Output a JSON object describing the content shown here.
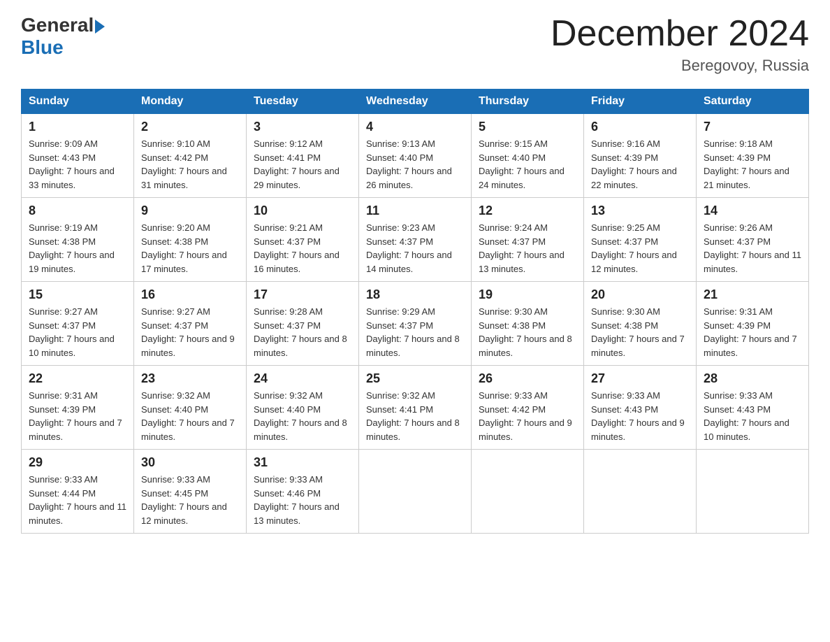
{
  "header": {
    "logo_general": "General",
    "logo_blue": "Blue",
    "title": "December 2024",
    "subtitle": "Beregovoy, Russia"
  },
  "columns": [
    "Sunday",
    "Monday",
    "Tuesday",
    "Wednesday",
    "Thursday",
    "Friday",
    "Saturday"
  ],
  "weeks": [
    [
      {
        "day": "1",
        "sunrise": "9:09 AM",
        "sunset": "4:43 PM",
        "daylight": "7 hours and 33 minutes."
      },
      {
        "day": "2",
        "sunrise": "9:10 AM",
        "sunset": "4:42 PM",
        "daylight": "7 hours and 31 minutes."
      },
      {
        "day": "3",
        "sunrise": "9:12 AM",
        "sunset": "4:41 PM",
        "daylight": "7 hours and 29 minutes."
      },
      {
        "day": "4",
        "sunrise": "9:13 AM",
        "sunset": "4:40 PM",
        "daylight": "7 hours and 26 minutes."
      },
      {
        "day": "5",
        "sunrise": "9:15 AM",
        "sunset": "4:40 PM",
        "daylight": "7 hours and 24 minutes."
      },
      {
        "day": "6",
        "sunrise": "9:16 AM",
        "sunset": "4:39 PM",
        "daylight": "7 hours and 22 minutes."
      },
      {
        "day": "7",
        "sunrise": "9:18 AM",
        "sunset": "4:39 PM",
        "daylight": "7 hours and 21 minutes."
      }
    ],
    [
      {
        "day": "8",
        "sunrise": "9:19 AM",
        "sunset": "4:38 PM",
        "daylight": "7 hours and 19 minutes."
      },
      {
        "day": "9",
        "sunrise": "9:20 AM",
        "sunset": "4:38 PM",
        "daylight": "7 hours and 17 minutes."
      },
      {
        "day": "10",
        "sunrise": "9:21 AM",
        "sunset": "4:37 PM",
        "daylight": "7 hours and 16 minutes."
      },
      {
        "day": "11",
        "sunrise": "9:23 AM",
        "sunset": "4:37 PM",
        "daylight": "7 hours and 14 minutes."
      },
      {
        "day": "12",
        "sunrise": "9:24 AM",
        "sunset": "4:37 PM",
        "daylight": "7 hours and 13 minutes."
      },
      {
        "day": "13",
        "sunrise": "9:25 AM",
        "sunset": "4:37 PM",
        "daylight": "7 hours and 12 minutes."
      },
      {
        "day": "14",
        "sunrise": "9:26 AM",
        "sunset": "4:37 PM",
        "daylight": "7 hours and 11 minutes."
      }
    ],
    [
      {
        "day": "15",
        "sunrise": "9:27 AM",
        "sunset": "4:37 PM",
        "daylight": "7 hours and 10 minutes."
      },
      {
        "day": "16",
        "sunrise": "9:27 AM",
        "sunset": "4:37 PM",
        "daylight": "7 hours and 9 minutes."
      },
      {
        "day": "17",
        "sunrise": "9:28 AM",
        "sunset": "4:37 PM",
        "daylight": "7 hours and 8 minutes."
      },
      {
        "day": "18",
        "sunrise": "9:29 AM",
        "sunset": "4:37 PM",
        "daylight": "7 hours and 8 minutes."
      },
      {
        "day": "19",
        "sunrise": "9:30 AM",
        "sunset": "4:38 PM",
        "daylight": "7 hours and 8 minutes."
      },
      {
        "day": "20",
        "sunrise": "9:30 AM",
        "sunset": "4:38 PM",
        "daylight": "7 hours and 7 minutes."
      },
      {
        "day": "21",
        "sunrise": "9:31 AM",
        "sunset": "4:39 PM",
        "daylight": "7 hours and 7 minutes."
      }
    ],
    [
      {
        "day": "22",
        "sunrise": "9:31 AM",
        "sunset": "4:39 PM",
        "daylight": "7 hours and 7 minutes."
      },
      {
        "day": "23",
        "sunrise": "9:32 AM",
        "sunset": "4:40 PM",
        "daylight": "7 hours and 7 minutes."
      },
      {
        "day": "24",
        "sunrise": "9:32 AM",
        "sunset": "4:40 PM",
        "daylight": "7 hours and 8 minutes."
      },
      {
        "day": "25",
        "sunrise": "9:32 AM",
        "sunset": "4:41 PM",
        "daylight": "7 hours and 8 minutes."
      },
      {
        "day": "26",
        "sunrise": "9:33 AM",
        "sunset": "4:42 PM",
        "daylight": "7 hours and 9 minutes."
      },
      {
        "day": "27",
        "sunrise": "9:33 AM",
        "sunset": "4:43 PM",
        "daylight": "7 hours and 9 minutes."
      },
      {
        "day": "28",
        "sunrise": "9:33 AM",
        "sunset": "4:43 PM",
        "daylight": "7 hours and 10 minutes."
      }
    ],
    [
      {
        "day": "29",
        "sunrise": "9:33 AM",
        "sunset": "4:44 PM",
        "daylight": "7 hours and 11 minutes."
      },
      {
        "day": "30",
        "sunrise": "9:33 AM",
        "sunset": "4:45 PM",
        "daylight": "7 hours and 12 minutes."
      },
      {
        "day": "31",
        "sunrise": "9:33 AM",
        "sunset": "4:46 PM",
        "daylight": "7 hours and 13 minutes."
      },
      null,
      null,
      null,
      null
    ]
  ]
}
